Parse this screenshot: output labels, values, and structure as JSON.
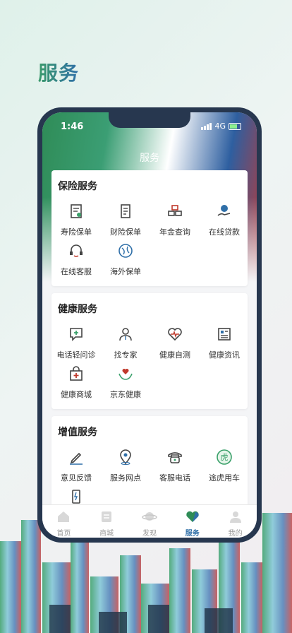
{
  "headline": "服务",
  "status": {
    "time": "1:46",
    "network": "4G"
  },
  "nav": {
    "title": "服务"
  },
  "sections": [
    {
      "title": "保险服务",
      "items": [
        {
          "label": "寿险保单",
          "icon": "document-icon"
        },
        {
          "label": "财险保单",
          "icon": "scroll-icon"
        },
        {
          "label": "年金查询",
          "icon": "gold-bars-icon"
        },
        {
          "label": "在线贷款",
          "icon": "loan-hand-icon"
        },
        {
          "label": "在线客服",
          "icon": "headset-icon"
        },
        {
          "label": "海外保单",
          "icon": "globe-icon"
        }
      ]
    },
    {
      "title": "健康服务",
      "items": [
        {
          "label": "电话轻问诊",
          "icon": "chat-plus-icon"
        },
        {
          "label": "找专家",
          "icon": "doctor-icon"
        },
        {
          "label": "健康自测",
          "icon": "heartbeat-icon"
        },
        {
          "label": "健康资讯",
          "icon": "news-icon"
        },
        {
          "label": "健康商城",
          "icon": "shopping-bag-icon"
        },
        {
          "label": "京东健康",
          "icon": "heart-hands-icon"
        }
      ]
    },
    {
      "title": "增值服务",
      "items": [
        {
          "label": "意见反馈",
          "icon": "pencil-icon"
        },
        {
          "label": "服务网点",
          "icon": "location-pin-icon"
        },
        {
          "label": "客服电话",
          "icon": "telephone-icon"
        },
        {
          "label": "途虎用车",
          "icon": "tiger-icon"
        },
        {
          "label": "",
          "icon": "phone-doc-icon"
        }
      ]
    }
  ],
  "tabs": [
    {
      "label": "首页",
      "icon": "home-icon",
      "active": false
    },
    {
      "label": "商城",
      "icon": "store-icon",
      "active": false
    },
    {
      "label": "发现",
      "icon": "planet-icon",
      "active": false
    },
    {
      "label": "服务",
      "icon": "heart-service-icon",
      "active": true
    },
    {
      "label": "我的",
      "icon": "profile-icon",
      "active": false
    }
  ],
  "colors": {
    "accent": "#2f6fa8",
    "green": "#2f8c57",
    "red": "#b63a3a",
    "phone_frame": "#27374f"
  }
}
